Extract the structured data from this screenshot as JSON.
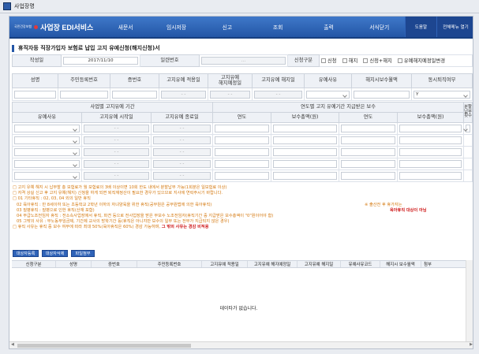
{
  "window": {
    "title": "사업장명"
  },
  "nav": {
    "org": "국민건강보험",
    "brand": "사업장 EDI서비스",
    "items": [
      "새문서",
      "임시저장",
      "신고",
      "조회",
      "출력",
      "서식닫기"
    ],
    "util": [
      "도움말",
      "전체메뉴 열기"
    ]
  },
  "page": {
    "title": "휴직자등 직장가입자 보험료 납입 고지 유예신청(해지신청)서"
  },
  "form": {
    "write_date_label": "작성일",
    "write_date_value": "2017/11/10",
    "serial_label": "일련번호",
    "serial_value": "...",
    "type_label": "신청구분",
    "type_options": [
      "신청",
      "해지",
      "신청+해지",
      "유예해지예정일변경"
    ],
    "main_headers": [
      "성명",
      "주민등록번호",
      "증번호",
      "고지유예 적용일",
      "고지유예\n해지예정일",
      "고지유예 해지일",
      "유예사유",
      "해지시보수월액",
      "동시퇴직여부"
    ],
    "main_row": {
      "apply_date": "- -",
      "end_plan": "- -",
      "end_date": "- -",
      "sel_y": "Y"
    },
    "period_header": "사업별 고지유예 기간",
    "period_sub": [
      "유예사유",
      "고지유예 시작일",
      "고지유예 종료일"
    ],
    "pay_header": "연도별 고지 유예기간 지급받은 보수",
    "pay_sub": [
      "연도",
      "보수총액(원)",
      "연도",
      "보수총액(원)"
    ],
    "last_header": "분할납부횟수",
    "period_rows": [
      [
        "- -",
        "- -"
      ],
      [
        "- -",
        "- -"
      ],
      [
        "- -",
        "- -"
      ],
      [
        "- -",
        "- -"
      ],
      [
        "- -",
        "- -"
      ]
    ]
  },
  "notes": [
    "고지 유예 해지 시 납부할 총 보험료가 월 보험료의 3배 이상이면 10회 한도 내에서 분할납부 가능(1회분은 일보험료 이상)",
    "자격 상실 신고 후 고지 유예(해지) 신청을 하게 되면 퇴직재정산이 필요한 경우가 있으므로 지사에 연락주시기 바랍니다.",
    "01 기타휴직 : 02, 03, 04 외의 일반 휴직",
    "02 육아휴직 : 만 8세이하 또는 초등학교 2학년 이하의 자녀양육을 위한 휴직(공무원은 공무원법에 의한 육아휴직)",
    "※ 출산전 후 휴가자는",
    "육아휴직 대상이 아님",
    "03 질병휴직 : 질병으로 인한 휴직(산재 포함)",
    "04 무급노조전임자 휴직 : 전소속사업장에서 휴직, 파견 등으로 전사업장을 받은 무보수 노조전임자(휴직기간 중 지급받은 보수총액이 \"0\"원이어야 함)",
    "05 그밖의 사유 : 무노동무임금제, 기간제 교사의 방학기간 등(휴직은 아니지만 보수의 일부 또는 전부가 지급되지 않은 경우)",
    "휴직 사유는 휴직 중 보수 여부에 따라 최대 50%(육아휴직은 60%) 경감 가능하며,",
    "그 밖의 사유는 경감 비적용"
  ],
  "buttons": [
    "대상자등록",
    "대상자삭제",
    "파일첨부"
  ],
  "grid": {
    "headers": [
      "신청구분",
      "성명",
      "증번호",
      "주민등록번호",
      "고지유예 적용일",
      "고지유예 해지예정일",
      "고지유예 해지일",
      "유예사유코드",
      "해지시 보수월액",
      "첨부"
    ],
    "empty_text": "데이타가 없습니다."
  },
  "colors": {
    "nav": "#2356a6",
    "note": "#d4770c",
    "warn": "#d02020"
  }
}
